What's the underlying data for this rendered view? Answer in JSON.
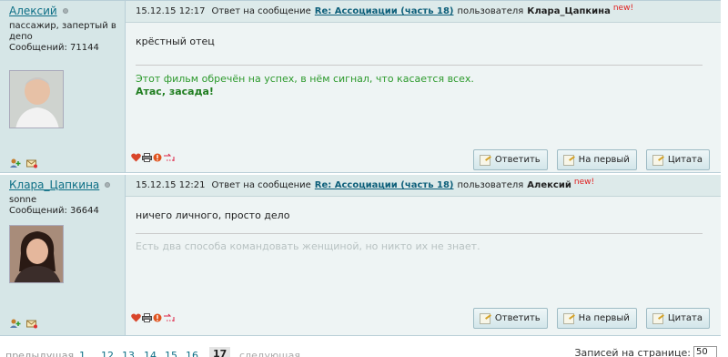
{
  "posts": [
    {
      "author": "Алексий",
      "author_title": "пассажир, запертый в депо",
      "author_count": "Сообщений: 71144",
      "date": "15.12.15 12:17",
      "reply_prefix": "Ответ на сообщение",
      "reply_link": "Re: Ассоциации (часть 18)",
      "user_prefix": "пользователя",
      "reply_user": "Клара_Цапкина",
      "new_label": "new!",
      "message": "крёстный отец",
      "signature_line1": "Этот фильм обречён на успех, в нём сигнал, что касается всех.",
      "signature_line2": "Атас, засада!"
    },
    {
      "author": "Клара_Цапкина",
      "author_title": "sonne",
      "author_count": "Сообщений: 36644",
      "date": "15.12.15 12:21",
      "reply_prefix": "Ответ на сообщение",
      "reply_link": "Re: Ассоциации (часть 18)",
      "user_prefix": "пользователя",
      "reply_user": "Алексий",
      "new_label": "new!",
      "message": "ничего личного, просто дело",
      "signature_line1": "Есть два способа командовать женщиной, но никто их не знает."
    }
  ],
  "buttons": {
    "reply": "Ответить",
    "to_first": "На первый",
    "quote": "Цитата"
  },
  "pager": {
    "prev": "предыдущая",
    "pages": [
      "1",
      "...",
      "12",
      "13",
      "14",
      "15",
      "16"
    ],
    "current": "17",
    "next": "следующая",
    "per_page_label": "Записей на странице:",
    "per_page_value": "50"
  },
  "colors": {
    "author_bg": "#d6e6e7",
    "header_bg": "#ddeaea",
    "link": "#0d6f86",
    "new_badge": "#e02020",
    "signature_green": "#2d9a2d"
  }
}
